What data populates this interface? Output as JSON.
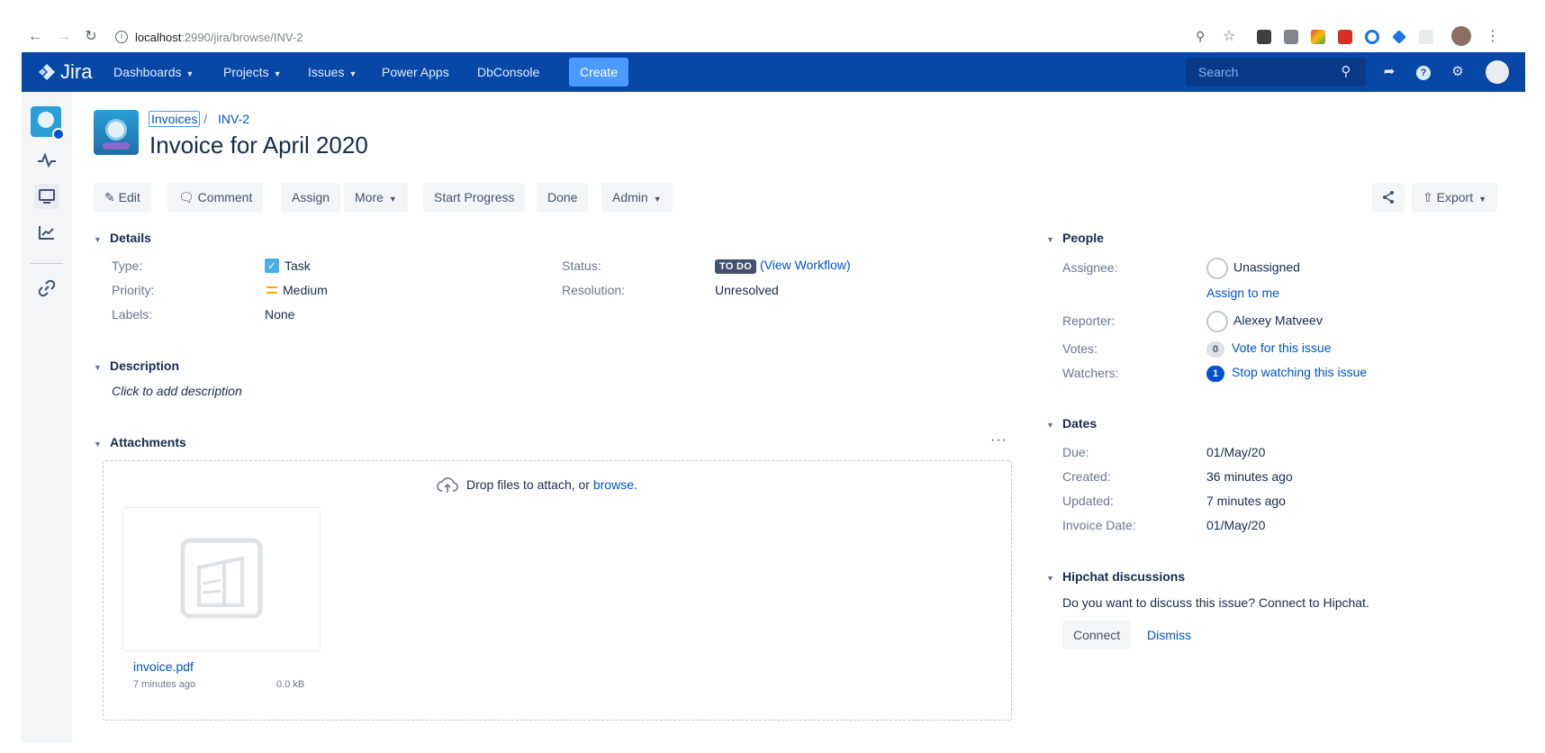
{
  "browser": {
    "url_host": "localhost",
    "url_path": ":2990/jira/browse/INV-2"
  },
  "topnav": {
    "logo": "Jira",
    "items": [
      "Dashboards",
      "Projects",
      "Issues",
      "Power Apps",
      "DbConsole"
    ],
    "create_label": "Create",
    "search_placeholder": "Search"
  },
  "header": {
    "breadcrumb_project": "Invoices",
    "breadcrumb_sep": "/",
    "breadcrumb_issue": "INV-2",
    "title": "Invoice for April 2020"
  },
  "toolbar": {
    "edit": "Edit",
    "comment": "Comment",
    "assign": "Assign",
    "more": "More",
    "start_progress": "Start Progress",
    "done": "Done",
    "admin": "Admin",
    "export": "Export"
  },
  "details": {
    "heading": "Details",
    "type_label": "Type:",
    "type_value": "Task",
    "priority_label": "Priority:",
    "priority_value": "Medium",
    "labels_label": "Labels:",
    "labels_value": "None",
    "status_label": "Status:",
    "status_badge": "TO DO",
    "view_workflow": "(View Workflow)",
    "resolution_label": "Resolution:",
    "resolution_value": "Unresolved"
  },
  "description": {
    "heading": "Description",
    "placeholder": "Click to add description"
  },
  "attachments": {
    "heading": "Attachments",
    "drop_text": "Drop files to attach, or",
    "browse_link": "browse.",
    "files": [
      {
        "name": "invoice.pdf",
        "age": "7 minutes ago",
        "size": "0.0 kB"
      }
    ]
  },
  "people": {
    "heading": "People",
    "assignee_label": "Assignee:",
    "assignee_value": "Unassigned",
    "assign_to_me": "Assign to me",
    "reporter_label": "Reporter:",
    "reporter_value": "Alexey Matveev",
    "votes_label": "Votes:",
    "votes_count": "0",
    "vote_link": "Vote for this issue",
    "watchers_label": "Watchers:",
    "watchers_count": "1",
    "watch_link": "Stop watching this issue"
  },
  "dates": {
    "heading": "Dates",
    "due_label": "Due:",
    "due_value": "01/May/20",
    "created_label": "Created:",
    "created_value": "36 minutes ago",
    "updated_label": "Updated:",
    "updated_value": "7 minutes ago",
    "invoice_date_label": "Invoice Date:",
    "invoice_date_value": "01/May/20"
  },
  "hipchat": {
    "heading": "Hipchat discussions",
    "text": "Do you want to discuss this issue? Connect to Hipchat.",
    "connect": "Connect",
    "dismiss": "Dismiss"
  },
  "colors": {
    "nav_bg": "#0747a6",
    "link": "#0052cc",
    "create": "#4c9aff"
  }
}
